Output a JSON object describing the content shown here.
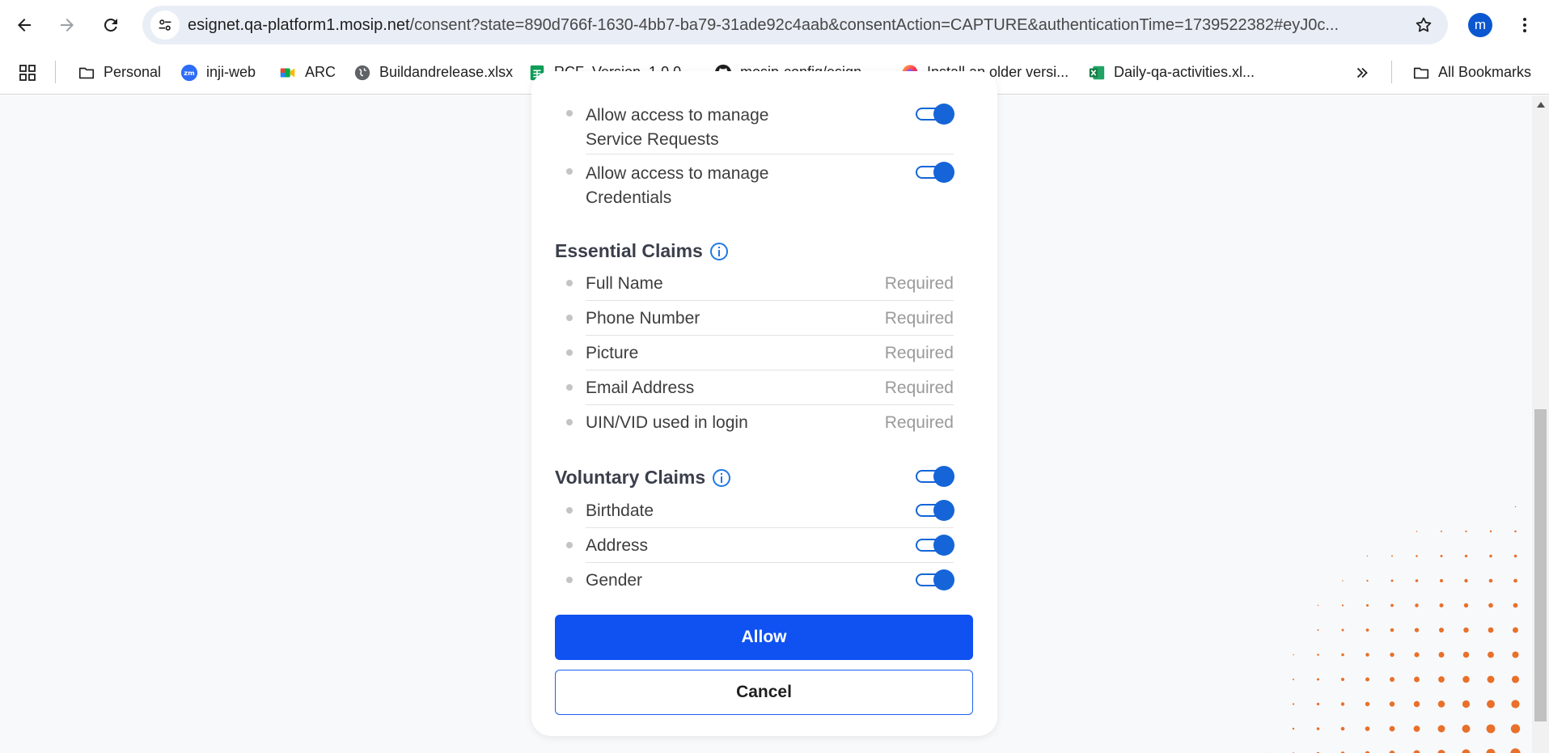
{
  "browser": {
    "url_host": "esignet.qa-platform1.mosip.net",
    "url_rest": "/consent?state=890d766f-1630-4bb7-ba79-31ade92c4aab&consentAction=CAPTURE&authenticationTime=1739522382#eyJ0c...",
    "profile_initial": "m"
  },
  "bookmarks": [
    {
      "label": "Personal",
      "icon": "folder-icon"
    },
    {
      "label": "inji-web",
      "icon": "zoom-icon"
    },
    {
      "label": "ARC",
      "icon": "meet-icon"
    },
    {
      "label": "Buildandrelease.xlsx",
      "icon": "globe-icon"
    },
    {
      "label": "RCF_Version_1.0.0 -...",
      "icon": "sheets-icon"
    },
    {
      "label": "mosip-config/esign...",
      "icon": "github-icon"
    },
    {
      "label": "Install an older versi...",
      "icon": "firefox-icon"
    },
    {
      "label": "Daily-qa-activities.xl...",
      "icon": "excel-icon"
    }
  ],
  "all_bookmarks_label": "All Bookmarks",
  "consent": {
    "authorize_scopes": [
      {
        "label_line1": "Allow access to manage",
        "label_line2": "Service Requests",
        "enabled": true
      },
      {
        "label_line1": "Allow access to manage",
        "label_line2": "Credentials",
        "enabled": true
      }
    ],
    "essential_title": "Essential Claims",
    "essential_claims": [
      {
        "label": "Full Name",
        "status": "Required"
      },
      {
        "label": "Phone Number",
        "status": "Required"
      },
      {
        "label": "Picture",
        "status": "Required"
      },
      {
        "label": "Email Address",
        "status": "Required"
      },
      {
        "label": "UIN/VID used in login",
        "status": "Required"
      }
    ],
    "voluntary_title": "Voluntary Claims",
    "voluntary_all_enabled": true,
    "voluntary_claims": [
      {
        "label": "Birthdate",
        "enabled": true
      },
      {
        "label": "Address",
        "enabled": true
      },
      {
        "label": "Gender",
        "enabled": true
      }
    ],
    "allow_label": "Allow",
    "cancel_label": "Cancel"
  },
  "colors": {
    "accent": "#1565d8",
    "allow_button": "#0f52f1",
    "decor_dots": "#e8702a"
  }
}
